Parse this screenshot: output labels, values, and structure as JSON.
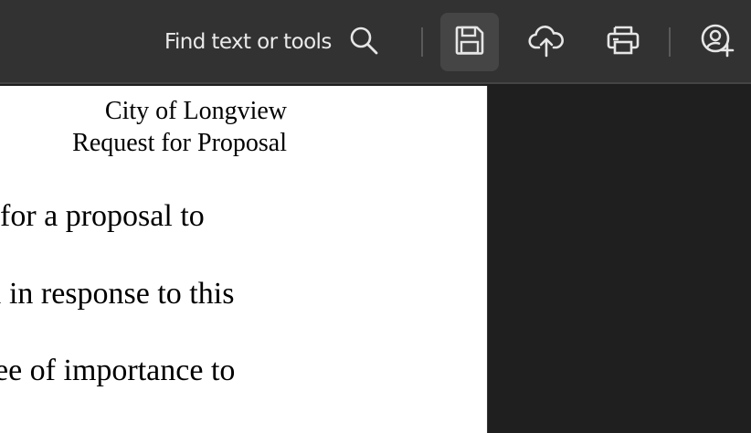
{
  "toolbar": {
    "search_label": "Find text or tools",
    "icons": {
      "search": "search-icon",
      "save": "save-icon",
      "upload": "cloud-upload-icon",
      "print": "print-icon",
      "share": "add-user-icon"
    }
  },
  "document": {
    "header_line_1": "City of Longview",
    "header_line_2": "Request for Proposal",
    "body_lines": [
      "for a proposal to",
      "l in response to this",
      "ee of importance to"
    ]
  },
  "colors": {
    "toolbar_bg": "#323232",
    "active_button_bg": "#454545",
    "icon_color": "#e6e6e6",
    "page_bg": "#ffffff",
    "side_panel_bg": "#1f1f1f"
  }
}
